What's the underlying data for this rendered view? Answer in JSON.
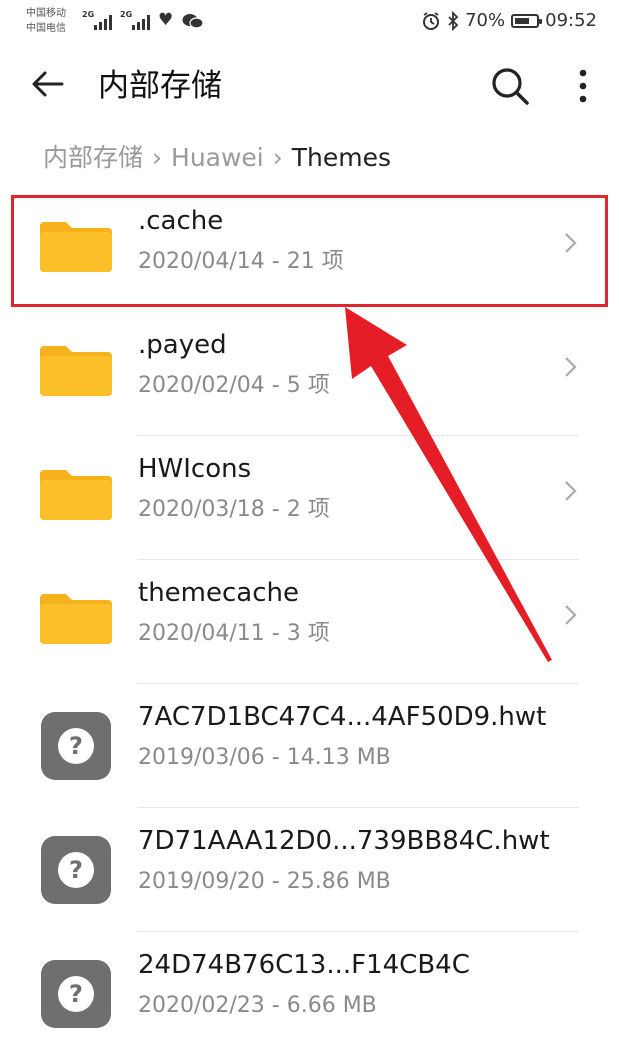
{
  "status": {
    "carrier1": "中国移动",
    "carrier2": "中国电信",
    "net1": "2G",
    "net2": "2G",
    "battery_text": "70%",
    "battery_level": 0.7,
    "time": "09:52"
  },
  "header": {
    "title": "内部存储"
  },
  "breadcrumb": [
    "内部存储",
    "Huawei",
    "Themes"
  ],
  "files": [
    {
      "name": ".cache",
      "meta": "2020/04/14 - 21 项",
      "type": "folder"
    },
    {
      "name": ".payed",
      "meta": "2020/02/04 - 5 项",
      "type": "folder"
    },
    {
      "name": "HWIcons",
      "meta": "2020/03/18 - 2 项",
      "type": "folder"
    },
    {
      "name": "themecache",
      "meta": "2020/04/11 - 3 项",
      "type": "folder"
    },
    {
      "name": "7AC7D1BC47C4...4AF50D9.hwt",
      "meta": "2019/03/06 - 14.13 MB",
      "type": "file"
    },
    {
      "name": "7D71AAA12D0...739BB84C.hwt",
      "meta": "2019/09/20 - 25.86 MB",
      "type": "file"
    },
    {
      "name": "24D74B76C13...F14CB4C",
      "meta": "2020/02/23 - 6.66 MB",
      "type": "file"
    }
  ],
  "colors": {
    "folder": "#fbbf27",
    "folder_tab": "#f5b21c",
    "highlight": "#e0262c",
    "unknown_icon": "#6f6f6f"
  }
}
